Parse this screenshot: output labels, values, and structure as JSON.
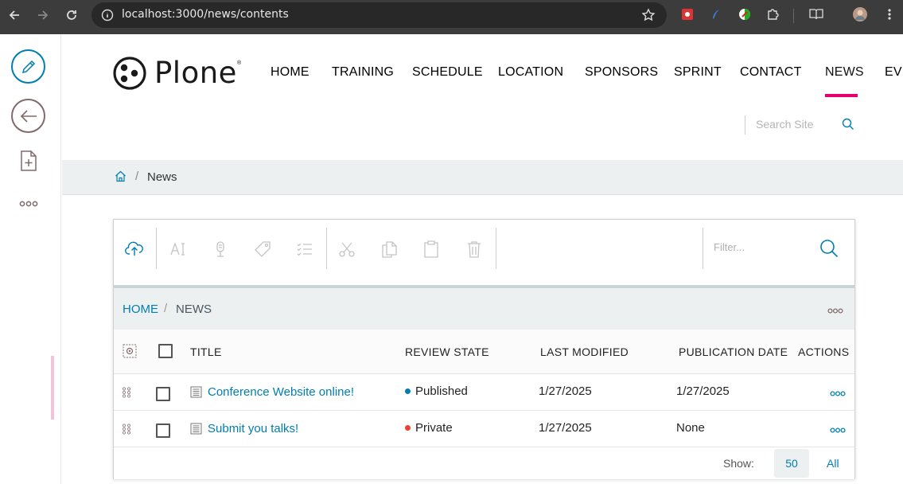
{
  "browser": {
    "url": "localhost:3000/news/contents"
  },
  "header": {
    "logo_text": "Plone",
    "logo_mark": "®",
    "nav": [
      "HOME",
      "TRAINING",
      "SCHEDULE",
      "LOCATION",
      "SPONSORS",
      "SPRINT",
      "CONTACT",
      "NEWS",
      "EVE"
    ],
    "active_nav": "NEWS",
    "search_placeholder": "Search Site"
  },
  "breadcrumb": {
    "separator": "/",
    "current": "News"
  },
  "contents": {
    "filter_placeholder": "Filter...",
    "path": {
      "home": "HOME",
      "separator": "/",
      "current": "NEWS"
    },
    "columns": {
      "title": "TITLE",
      "review_state": "REVIEW STATE",
      "last_modified": "LAST MODIFIED",
      "publication_date": "PUBLICATION DATE",
      "actions": "ACTIONS"
    },
    "rows": [
      {
        "title": "Conference Website online!",
        "state": "Published",
        "state_color": "#007eb1",
        "modified": "1/27/2025",
        "published": "1/27/2025"
      },
      {
        "title": "Submit you talks!",
        "state": "Private",
        "state_color": "#ed4033",
        "modified": "1/27/2025",
        "published": "None"
      }
    ],
    "footer": {
      "show_label": "Show:",
      "page_size": "50",
      "all": "All"
    }
  },
  "colors": {
    "accent": "#007eb1",
    "active_underline": "#e8006f",
    "toolbar_icon": "#826a6a"
  }
}
